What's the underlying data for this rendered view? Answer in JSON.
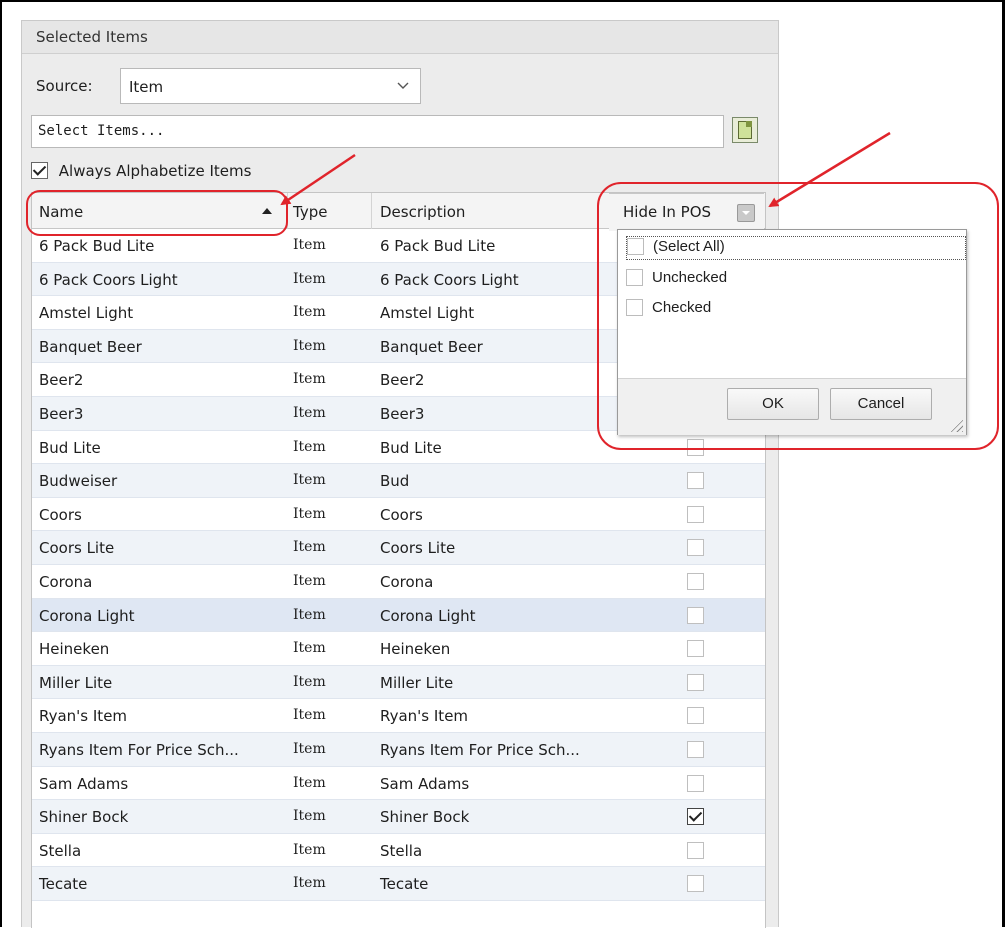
{
  "panel": {
    "title": "Selected Items",
    "source_label": "Source:",
    "source_value": "Item",
    "select_items_placeholder": "Select Items...",
    "always_alphabetize_label": "Always Alphabetize Items",
    "always_alphabetize_checked": true
  },
  "grid": {
    "columns": [
      "Name",
      "Type",
      "Description",
      "Hide In POS"
    ],
    "sort": {
      "column": "Name",
      "direction": "ascending"
    },
    "rows": [
      {
        "name": "6 Pack Bud Lite",
        "type": "Item",
        "description": "6 Pack Bud Lite",
        "hide": false
      },
      {
        "name": "6 Pack Coors Light",
        "type": "Item",
        "description": "6 Pack Coors Light",
        "hide": false
      },
      {
        "name": "Amstel Light",
        "type": "Item",
        "description": "Amstel Light",
        "hide": false
      },
      {
        "name": "Banquet Beer",
        "type": "Item",
        "description": "Banquet Beer",
        "hide": false
      },
      {
        "name": "Beer2",
        "type": "Item",
        "description": "Beer2",
        "hide": false
      },
      {
        "name": "Beer3",
        "type": "Item",
        "description": "Beer3",
        "hide": false
      },
      {
        "name": "Bud Lite",
        "type": "Item",
        "description": "Bud Lite",
        "hide": false
      },
      {
        "name": "Budweiser",
        "type": "Item",
        "description": "Bud",
        "hide": false
      },
      {
        "name": "Coors",
        "type": "Item",
        "description": "Coors",
        "hide": false
      },
      {
        "name": "Coors Lite",
        "type": "Item",
        "description": "Coors Lite",
        "hide": false
      },
      {
        "name": "Corona",
        "type": "Item",
        "description": "Corona",
        "hide": false
      },
      {
        "name": "Corona Light",
        "type": "Item",
        "description": "Corona Light",
        "hide": false,
        "selected": true
      },
      {
        "name": "Heineken",
        "type": "Item",
        "description": "Heineken",
        "hide": false
      },
      {
        "name": "Miller Lite",
        "type": "Item",
        "description": "Miller Lite",
        "hide": false
      },
      {
        "name": "Ryan's Item",
        "type": "Item",
        "description": "Ryan's Item",
        "hide": false
      },
      {
        "name": "Ryans Item For Price Sch...",
        "type": "Item",
        "description": "Ryans Item For Price Sch...",
        "hide": false
      },
      {
        "name": "Sam Adams",
        "type": "Item",
        "description": "Sam Adams",
        "hide": false
      },
      {
        "name": "Shiner Bock",
        "type": "Item",
        "description": "Shiner Bock",
        "hide": true
      },
      {
        "name": "Stella",
        "type": "Item",
        "description": "Stella",
        "hide": false
      },
      {
        "name": "Tecate",
        "type": "Item",
        "description": "Tecate",
        "hide": false
      }
    ]
  },
  "filter_popup": {
    "column_label": "Hide In POS",
    "options": [
      {
        "label": "(Select All)",
        "checked": false
      },
      {
        "label": "Unchecked",
        "checked": false
      },
      {
        "label": "Checked",
        "checked": false
      }
    ],
    "ok_label": "OK",
    "cancel_label": "Cancel"
  },
  "colors": {
    "annotation": "#e0242b",
    "row_alt": "#eff3f8",
    "row_selected": "#dfe7f3"
  },
  "icons": {
    "source_dropdown": "chevron-down-icon",
    "picker": "item-picker-icon",
    "sort": "sort-ascending-icon",
    "filter": "filter-dropdown-icon",
    "resize": "resize-grip-icon"
  }
}
